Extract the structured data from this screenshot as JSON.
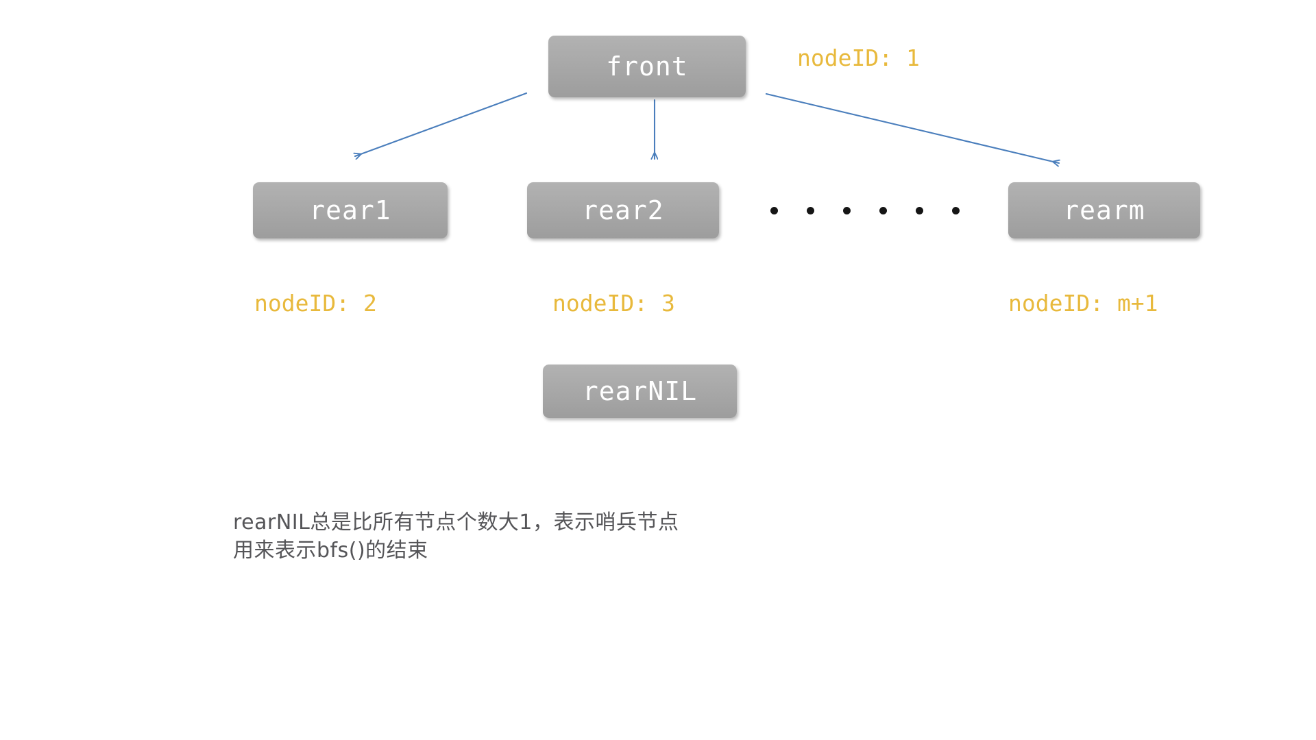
{
  "diagram": {
    "title": "BFS queue node diagram",
    "background_color": "#ffffff",
    "node_fill_top": "#b2b2b2",
    "node_fill_bottom": "#9d9d9d",
    "node_text_color": "#ffffff",
    "nodeid_color": "#e8b93c",
    "arrow_color": "#4a7ebc",
    "caption_color": "#555558",
    "dot_color": "#151515"
  },
  "nodes": {
    "front": {
      "label": "front",
      "nodeid": "nodeID: 1"
    },
    "rear1": {
      "label": "rear1",
      "nodeid": "nodeID: 2"
    },
    "rear2": {
      "label": "rear2",
      "nodeid": "nodeID: 3"
    },
    "rearm": {
      "label": "rearm",
      "nodeid": "nodeID: m+1"
    },
    "rearnil": {
      "label": "rearNIL"
    }
  },
  "ellipsis": {
    "dot_count": 6
  },
  "arrows": [
    {
      "name": "front-to-rear1",
      "from": "front",
      "to": "rear1"
    },
    {
      "name": "front-to-rear2",
      "from": "front",
      "to": "rear2"
    },
    {
      "name": "front-to-rearm",
      "from": "front",
      "to": "rearm"
    }
  ],
  "caption": {
    "line1": "rearNIL总是比所有节点个数大1，表示哨兵节点",
    "line2": "用来表示bfs()的结束",
    "text": "rearNIL总是比所有节点个数大1，表示哨兵节点\n用来表示bfs()的结束"
  }
}
